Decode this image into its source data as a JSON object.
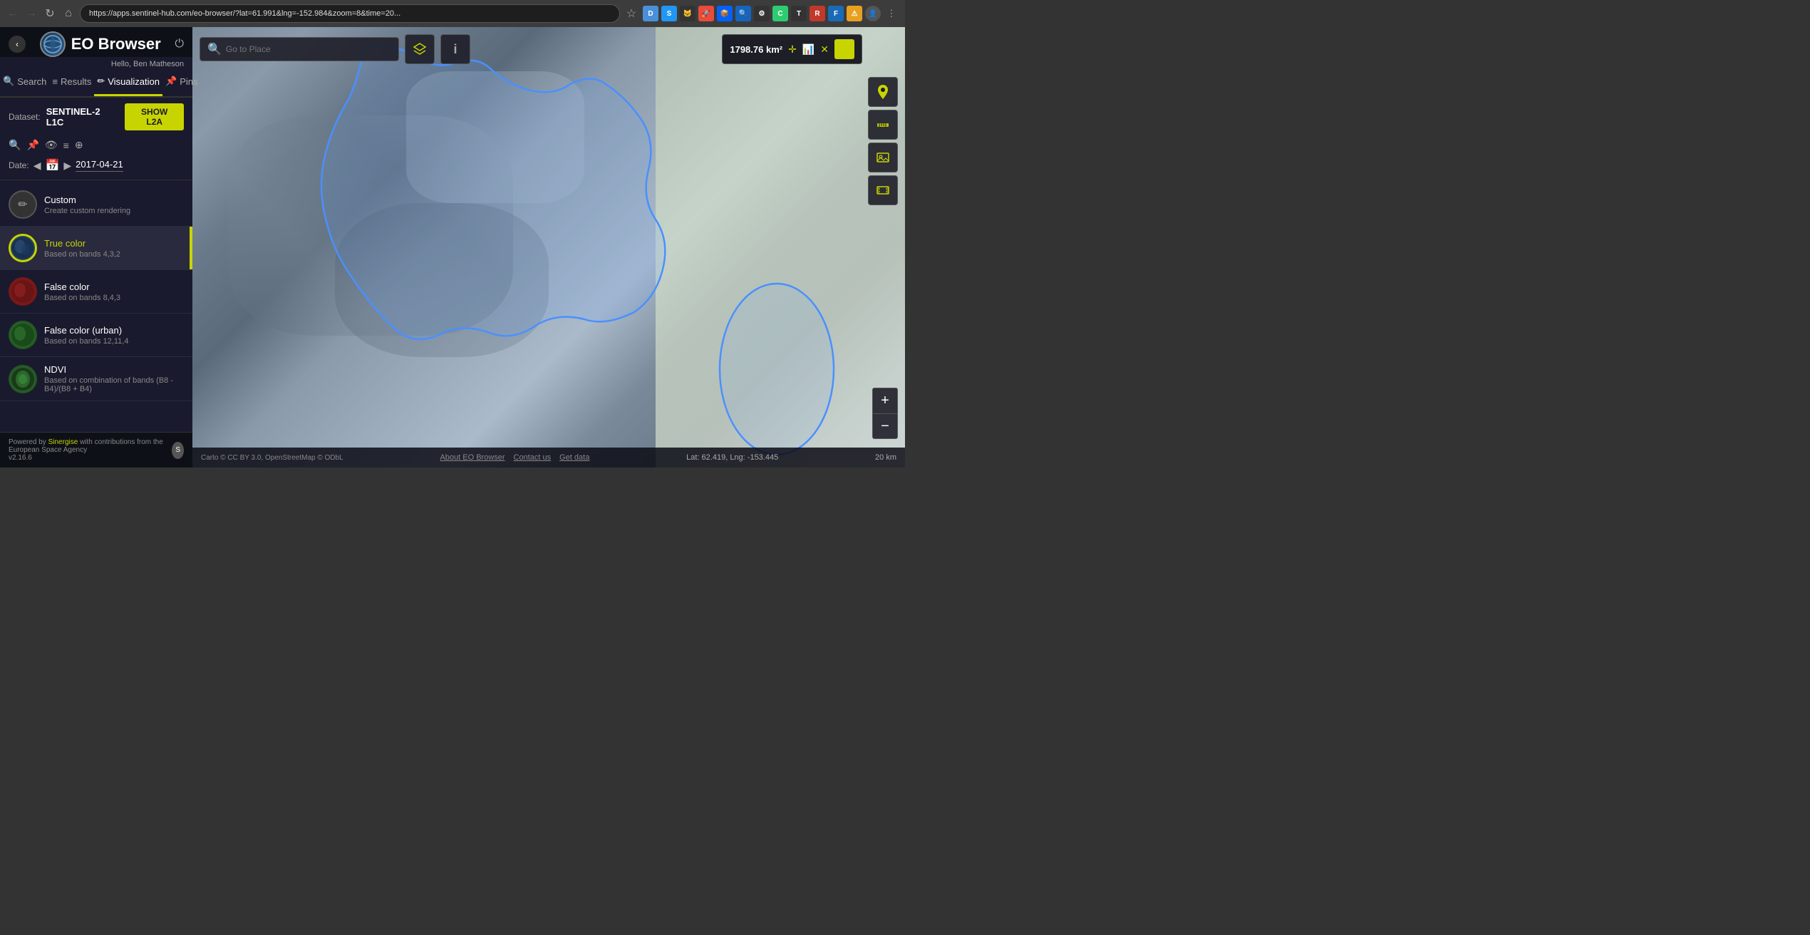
{
  "browser": {
    "back_disabled": true,
    "forward_disabled": true,
    "url": "https://apps.sentinel-hub.com/eo-browser/?lat=61.991&lng=-152.984&zoom=8&time=20...",
    "star_title": "Bookmark this page"
  },
  "app": {
    "title": "EO Browser",
    "collapse_label": "‹",
    "power_label": "⏻",
    "greeting": "Hello, Ben Matheson"
  },
  "nav": {
    "tabs": [
      {
        "id": "search",
        "label": "Search",
        "icon": "🔍",
        "active": false
      },
      {
        "id": "results",
        "label": "Results",
        "icon": "≡",
        "active": false
      },
      {
        "id": "visualization",
        "label": "Visualization",
        "icon": "✏",
        "active": true
      },
      {
        "id": "pins",
        "label": "Pins",
        "icon": "📌",
        "active": false
      }
    ]
  },
  "dataset": {
    "label": "Dataset:",
    "name": "SENTINEL-2 L1C",
    "show_l2a": "SHOW L2A",
    "icons": [
      "🔍",
      "📌",
      "👁",
      "≡",
      "⊕"
    ]
  },
  "date": {
    "label": "Date:",
    "value": "2017-04-21",
    "prev": "◀",
    "next": "▶",
    "calendar": "📅"
  },
  "visualizations": [
    {
      "id": "custom",
      "name": "Custom",
      "desc": "Create custom rendering",
      "active": false,
      "thumb_type": "custom"
    },
    {
      "id": "true-color",
      "name": "True color",
      "desc": "Based on bands 4,3,2",
      "active": true,
      "thumb_type": "true-color"
    },
    {
      "id": "false-color",
      "name": "False color",
      "desc": "Based on bands 8,4,3",
      "active": false,
      "thumb_type": "false-color"
    },
    {
      "id": "false-urban",
      "name": "False color (urban)",
      "desc": "Based on bands 12,11,4",
      "active": false,
      "thumb_type": "false-urban"
    },
    {
      "id": "ndvi",
      "name": "NDVI",
      "desc": "Based on combination of bands (B8 - B4)/(B8 + B4)",
      "active": false,
      "thumb_type": "ndvi"
    }
  ],
  "footer": {
    "powered_by": "Powered by ",
    "sinergise": "Sinergise",
    "rest": " with contributions from the European Space Agency",
    "version": "v2.16.6"
  },
  "map": {
    "search_placeholder": "Go to Place",
    "area_km2": "1798.76 km²",
    "coords": "Lat: 62.419, Lng: -153.445",
    "scale": "20 km",
    "attribution": "Carto © CC BY 3.0, OpenStreetMap © ODbL",
    "footer_links": [
      "About EO Browser",
      "Contact us",
      "Get data"
    ]
  }
}
